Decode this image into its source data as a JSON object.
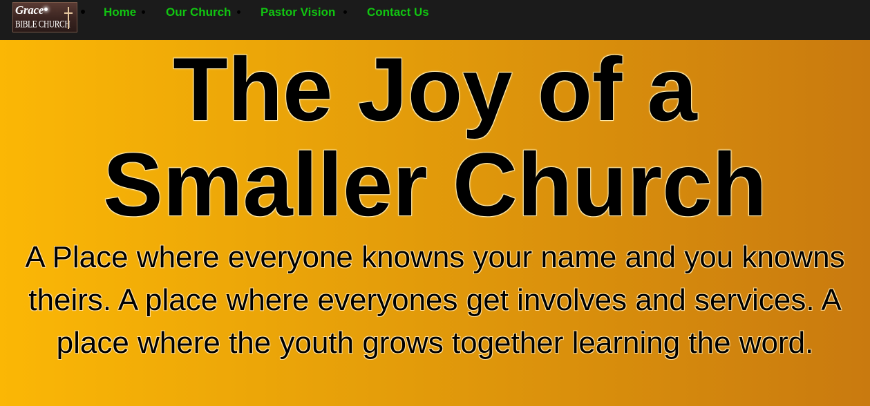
{
  "logo": {
    "word": "Grace",
    "subtitle": "BIBLE CHURCH"
  },
  "nav": {
    "items": [
      {
        "label": "Home"
      },
      {
        "label": "Our Church"
      },
      {
        "label": "Pastor Vision"
      },
      {
        "label": "Contact Us"
      }
    ],
    "link_color": "#11c611",
    "bar_color": "#1b1b1b"
  },
  "hero": {
    "title": "The Joy of a Smaller Church",
    "description": "A Place where everyone knowns your name and you knowns theirs. A place where everyones get involves and services. A place where the youth grows together learning the word.",
    "gradient_start": "#fbb705",
    "gradient_end": "#c97a0f"
  }
}
